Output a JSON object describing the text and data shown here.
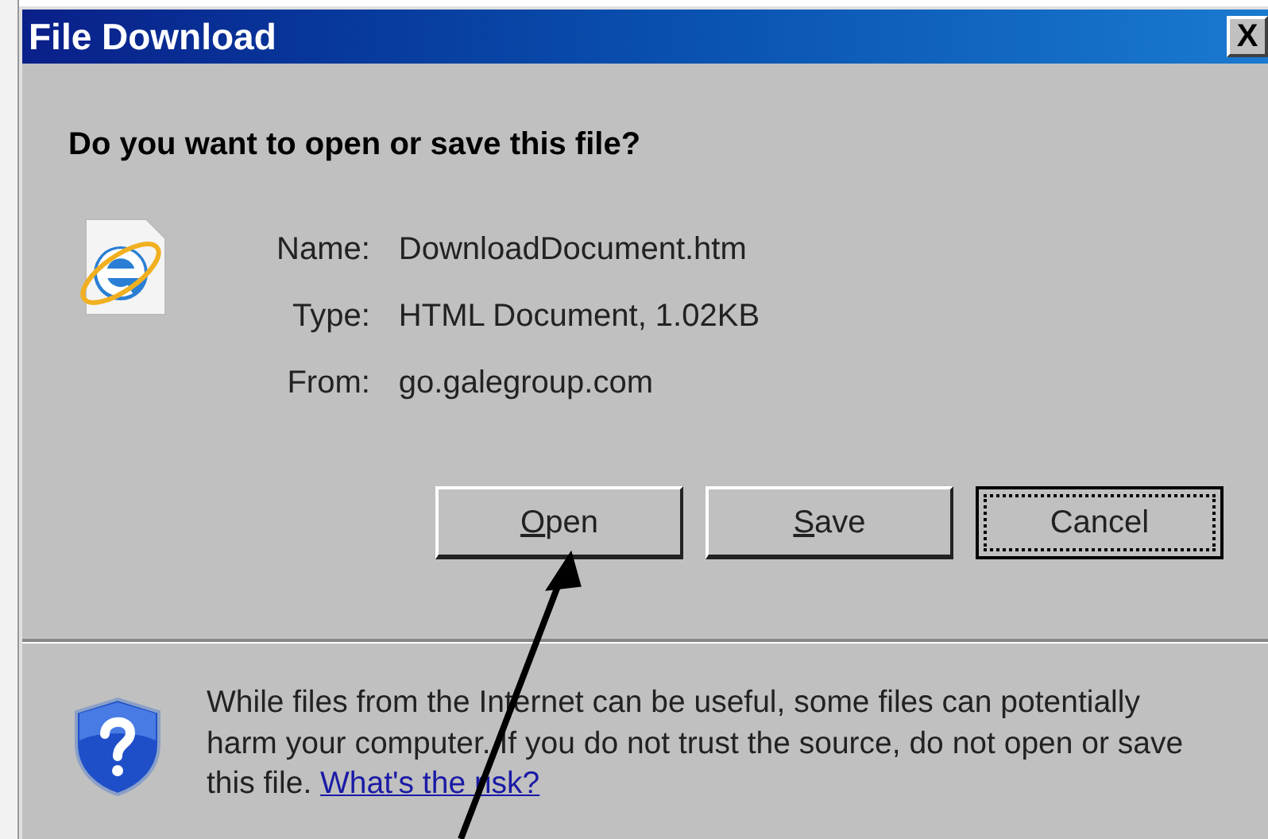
{
  "window": {
    "title": "File Download",
    "close": "X"
  },
  "question": "Do you want to open or save this file?",
  "file_info": [
    {
      "label": "Name:",
      "value": "DownloadDocument.htm"
    },
    {
      "label": "Type:",
      "value": "HTML Document, 1.02KB"
    },
    {
      "label": "From:",
      "value": "go.galegroup.com"
    }
  ],
  "buttons": [
    {
      "label": "Open",
      "underline_first": true,
      "focused": false
    },
    {
      "label": "Save",
      "underline_first": true,
      "focused": false
    },
    {
      "label": "Cancel",
      "underline_first": false,
      "focused": true
    }
  ],
  "warning": {
    "text": "While files from the Internet can be useful, some files can potentially harm your computer. If you do not trust the source, do not open or save this file.",
    "link": "What's the risk?"
  }
}
